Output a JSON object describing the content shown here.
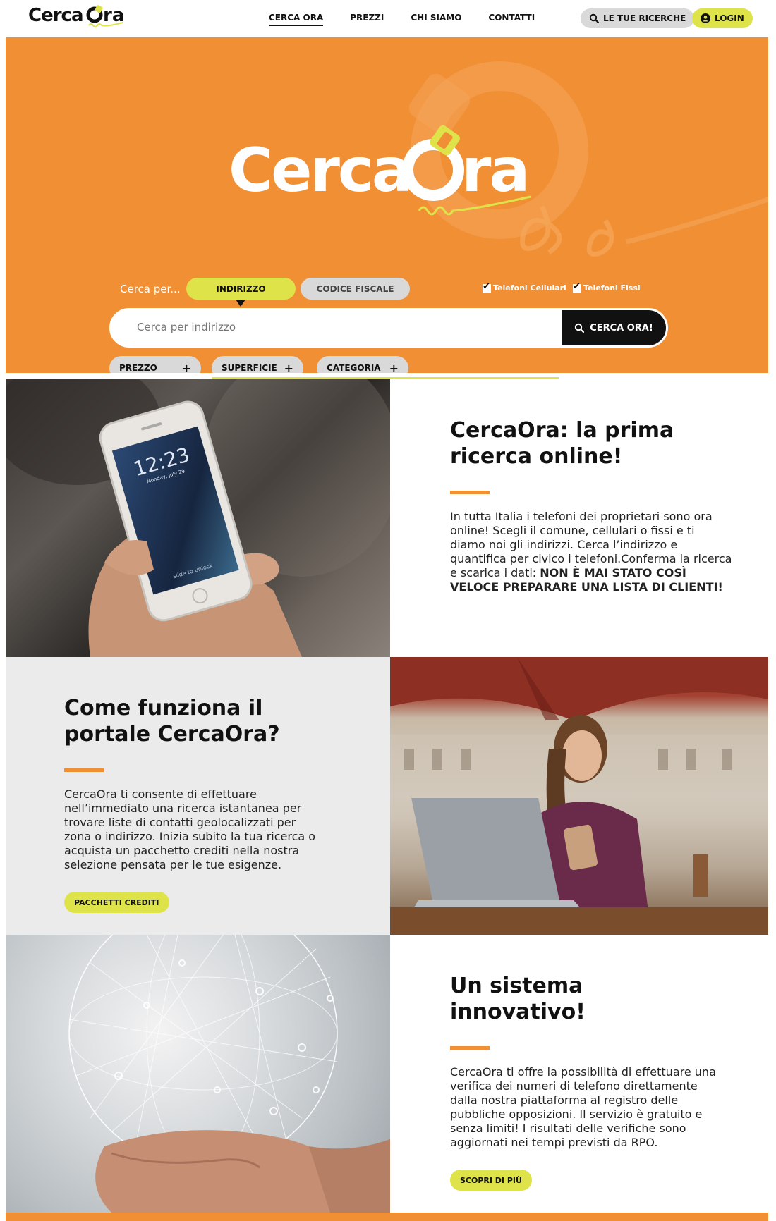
{
  "brand": {
    "name": "CercaOra",
    "accent": "#f08f34",
    "highlight": "#dfe34a",
    "dark": "#111111"
  },
  "header": {
    "logo_text": "CercaOra",
    "nav": [
      {
        "label": "CERCA ORA",
        "active": true
      },
      {
        "label": "PREZZI",
        "active": false
      },
      {
        "label": "CHI SIAMO",
        "active": false
      },
      {
        "label": "CONTATTI",
        "active": false
      }
    ],
    "searches_label": "LE TUE RICERCHE",
    "login_label": "LOGIN"
  },
  "hero": {
    "logo_text_left": "Cerca",
    "logo_text_right": "ra",
    "search_by_label": "Cerca per...",
    "tabs": [
      {
        "label": "INDIRIZZO",
        "active": true
      },
      {
        "label": "CODICE FISCALE",
        "active": false
      }
    ],
    "checkboxes": [
      {
        "label": "Telefoni Cellulari",
        "checked": true
      },
      {
        "label": "Telefoni Fissi",
        "checked": true
      }
    ],
    "search": {
      "placeholder": "Cerca per indirizzo",
      "button_label": "CERCA ORA!"
    },
    "filters": [
      {
        "label": "PREZZO"
      },
      {
        "label": "SUPERFICIE"
      },
      {
        "label": "CATEGORIA"
      }
    ]
  },
  "sections": [
    {
      "title": "CercaOra: la prima ricerca online!",
      "body": "In tutta Italia i telefoni dei proprietari sono ora online! Scegli il comune, cellulari o fissi e ti diamo noi gli indirizzi. Cerca l’indirizzo e quantifica per civico i telefoni.Conferma la ricerca e scarica i dati: ",
      "body_bold": "NON È MAI STATO COSÌ VELOCE PREPARARE UNA LISTA DI CLIENTI!",
      "image": "hand-holding-smartphone"
    },
    {
      "title": "Come funziona il portale CercaOra?",
      "body": "CercaOra ti consente di effettuare nell’immediato una ricerca istantanea per trovare liste di contatti geolocalizzati per zona o indirizzo. Inizia subito la tua ricerca o acquista un pacchetto crediti nella nostra selezione pensata per le tue esigenze.",
      "cta": "PACCHETTI CREDITI",
      "image": "woman-with-laptop-and-phone"
    },
    {
      "title": "Un sistema innovativo!",
      "body": "CercaOra ti offre la possibilità di effettuare una verifica dei numeri di telefono direttamente dalla nostra piattaforma al registro delle pubbliche opposizioni. Il servizio è gratuito e senza limiti! I risultati delle verifiche sono aggiornati nei tempi previsti da RPO.",
      "cta": "SCOPRI DI PIÙ",
      "image": "hand-with-network-globe"
    }
  ],
  "phone_screen": {
    "time": "12:23",
    "date": "Monday, July 29",
    "unlock": "slide to unlock"
  }
}
